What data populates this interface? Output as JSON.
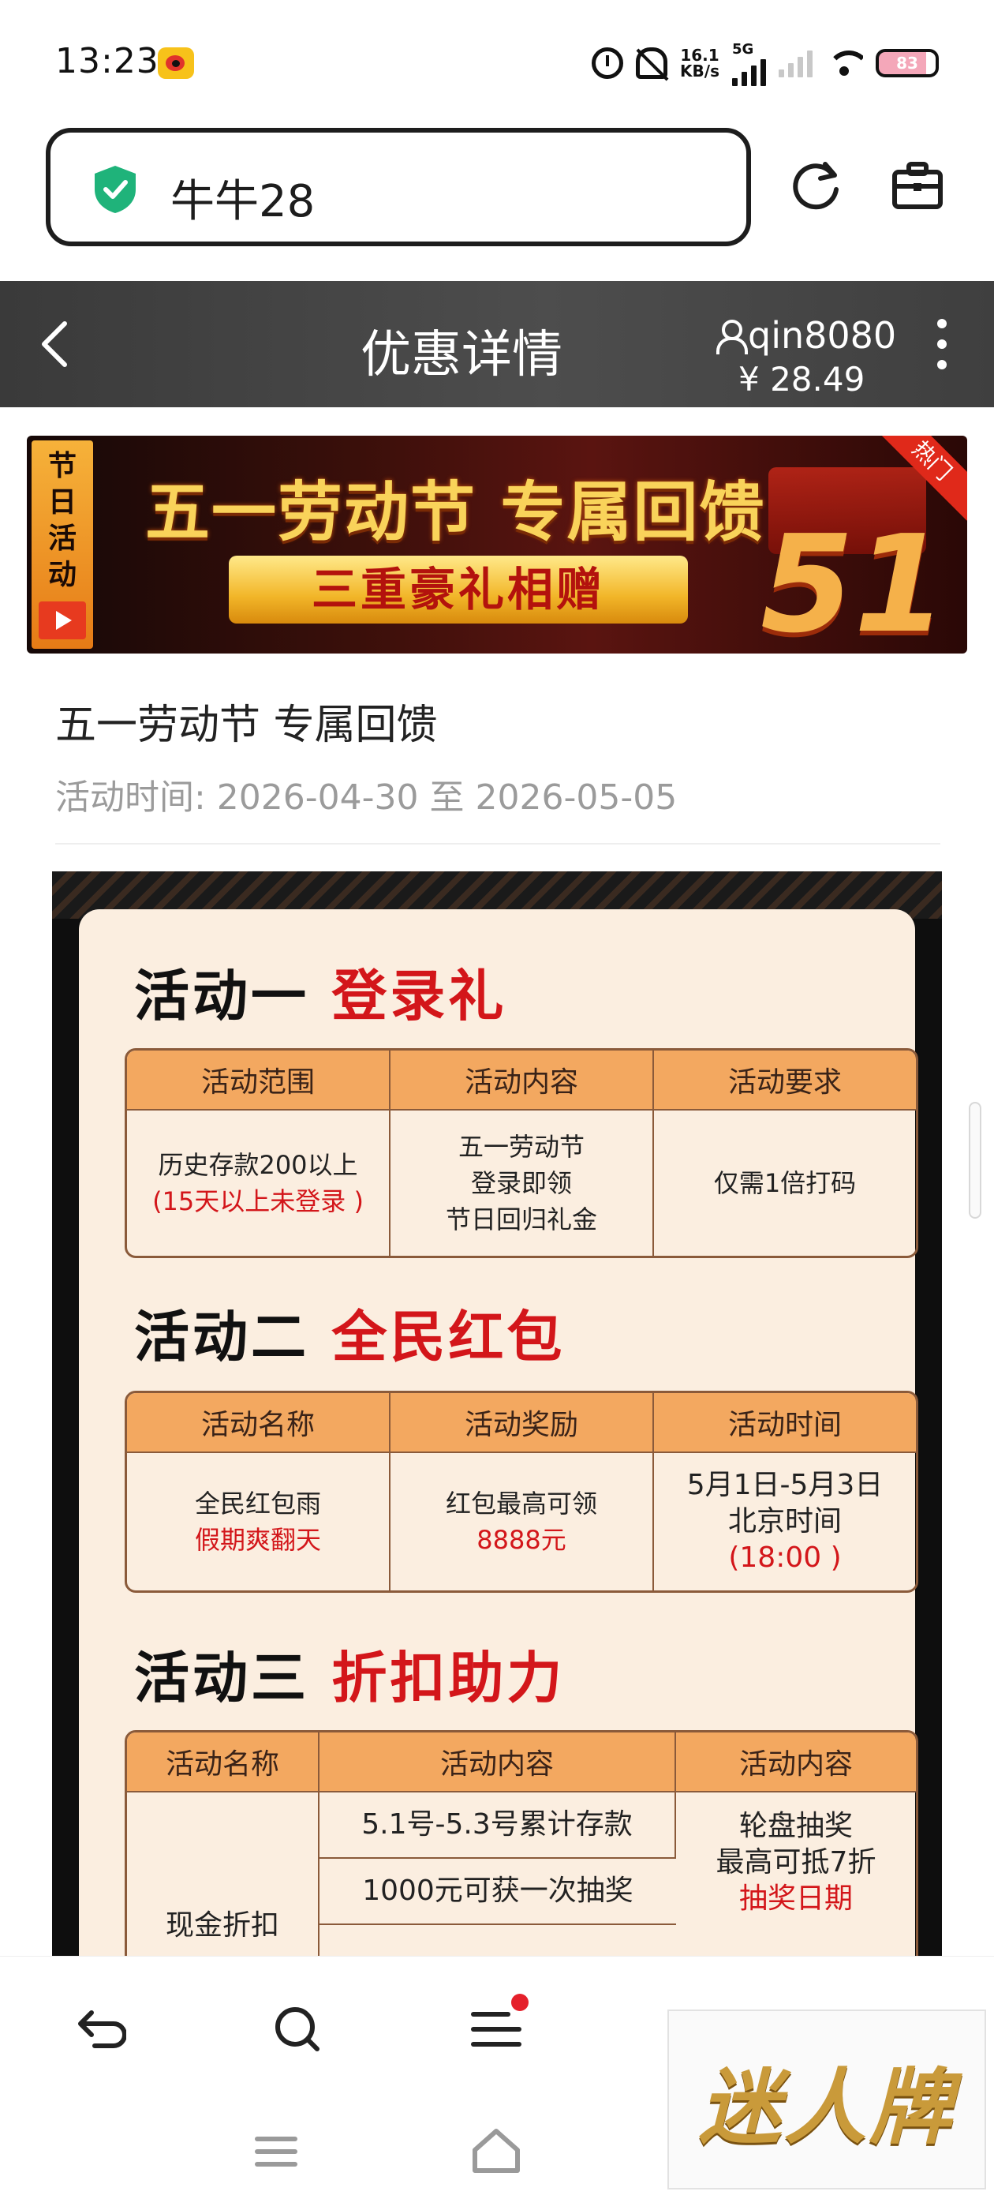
{
  "status_bar": {
    "time": "13:23",
    "net_speed_value": "16.1",
    "net_speed_unit": "KB/s",
    "network_type": "5G",
    "battery": "83"
  },
  "browser": {
    "url_text": "牛牛28"
  },
  "header": {
    "title": "优惠详情",
    "username": "qin8080",
    "balance": "¥ 28.49"
  },
  "banner": {
    "tag_lines": [
      "节",
      "日",
      "活",
      "动"
    ],
    "title": "五一劳动节 专属回馈",
    "subtitle": "三重豪礼相赠",
    "badge": "51",
    "hot_label": "热门"
  },
  "promo": {
    "title": "五一劳动节 专属回馈",
    "time_label": "活动时间: 2026-04-30 至 2026-05-05"
  },
  "sections": [
    {
      "head_prefix": "活动一",
      "head_accent": "登录礼",
      "columns": [
        "活动范围",
        "活动内容",
        "活动要求"
      ],
      "row": {
        "c1_line1": "历史存款200以上",
        "c1_line2": "(15天以上未登录 )",
        "c2_line1": "五一劳动节",
        "c2_line2": "登录即领",
        "c2_line3": "节日回归礼金",
        "c3_line1": "仅需1倍打码"
      }
    },
    {
      "head_prefix": "活动二",
      "head_accent": "全民红包",
      "columns": [
        "活动名称",
        "活动奖励",
        "活动时间"
      ],
      "row": {
        "c1_line1": "全民红包雨",
        "c1_line2": "假期爽翻天",
        "c2_line1": "红包最高可领",
        "c2_line2": "8888元",
        "c3_line1": "5月1日-5月3日",
        "c3_line2": "北京时间",
        "c3_line3": "(18:00 )"
      }
    },
    {
      "head_prefix": "活动三",
      "head_accent": "折扣助力",
      "columns": [
        "活动名称",
        "活动内容",
        "活动内容"
      ],
      "row": {
        "c1_line1": "现金折扣",
        "c2_line1": "5.1号-5.3号累计存款",
        "c2_line2": "1000元可获一次抽奖",
        "c3_line1": "轮盘抽奖",
        "c3_line2": "最高可抵7折",
        "c3_line3": "抽奖日期"
      }
    }
  ],
  "ad": {
    "text": "迷人牌"
  },
  "colors": {
    "header_bg": "#444444",
    "table_header": "#f3a860",
    "accent_red": "#d3161a",
    "card_bg": "#fbeee0",
    "shield_green": "#1fb37a"
  },
  "icons": [
    "shield-icon",
    "refresh-icon",
    "briefcase-icon",
    "back-icon",
    "user-icon",
    "more-icon",
    "undo-icon",
    "search-icon",
    "menu-icon",
    "home-icon",
    "nav-menu-icon"
  ]
}
